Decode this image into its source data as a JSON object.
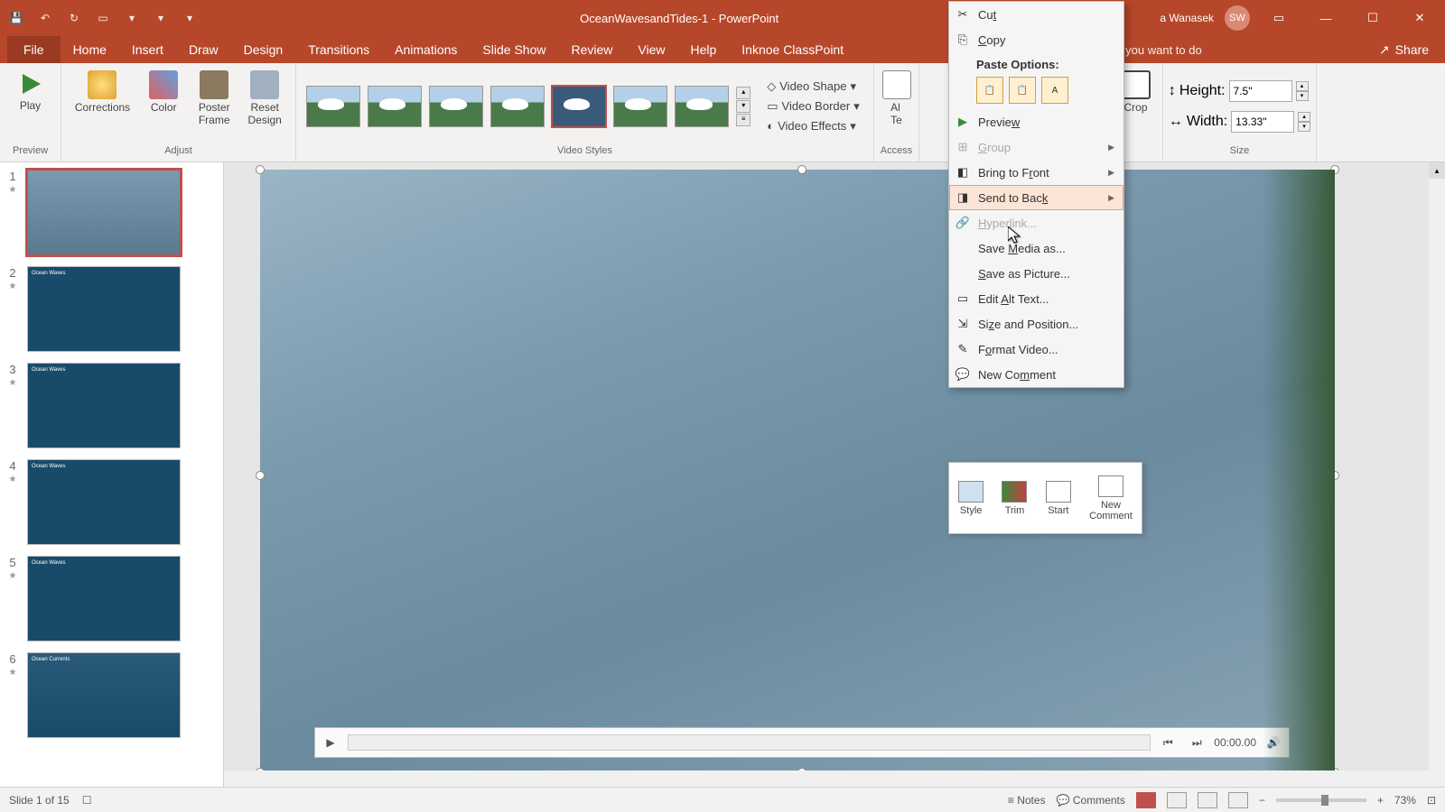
{
  "titlebar": {
    "title": "OceanWavesandTides-1 - PowerPoint",
    "user": "a Wanasek",
    "initials": "SW"
  },
  "tabs": {
    "file": "File",
    "home": "Home",
    "insert": "Insert",
    "draw": "Draw",
    "design": "Design",
    "transitions": "Transitions",
    "animations": "Animations",
    "slideshow": "Slide Show",
    "review": "Review",
    "view": "View",
    "help": "Help",
    "classpoint": "Inknoe ClassPoint",
    "tellme": "Tell me what you want to do",
    "share": "Share"
  },
  "ribbon": {
    "play": "Play",
    "preview": "Preview",
    "corrections": "Corrections",
    "color": "Color",
    "poster": "Poster\nFrame",
    "reset": "Reset\nDesign",
    "adjust": "Adjust",
    "videostyles": "Video Styles",
    "vshape": "Video Shape",
    "vborder": "Video Border",
    "veffects": "Video Effects",
    "alt": "Al\nTe",
    "access": "Access",
    "crop": "Crop",
    "height_label": "Height:",
    "height_val": "7.5\"",
    "width_label": "Width:",
    "width_val": "13.33\"",
    "size": "Size"
  },
  "ctx": {
    "cut": "Cut",
    "copy": "Copy",
    "paste_options": "Paste Options:",
    "preview": "Preview",
    "group": "Group",
    "bringfront": "Bring to Front",
    "sendback": "Send to Back",
    "hyperlink": "Hyperlink...",
    "savemedia": "Save Media as...",
    "savepic": "Save as Picture...",
    "editalt": "Edit Alt Text...",
    "sizepos": "Size and Position...",
    "formatvideo": "Format Video...",
    "newcomment": "New Comment"
  },
  "mini": {
    "style": "Style",
    "trim": "Trim",
    "start": "Start",
    "newcomment": "New\nComment"
  },
  "playbar": {
    "time": "00:00.00"
  },
  "status": {
    "slideinfo": "Slide 1 of 15",
    "notes": "Notes",
    "comments": "Comments",
    "zoom": "73%"
  },
  "thumbs": {
    "t2_title": "Ocean Waves",
    "t3_title": "Ocean Waves",
    "t4_title": "Ocean Waves",
    "t5_title": "Ocean Waves",
    "t6_title": "Ocean Currents"
  }
}
